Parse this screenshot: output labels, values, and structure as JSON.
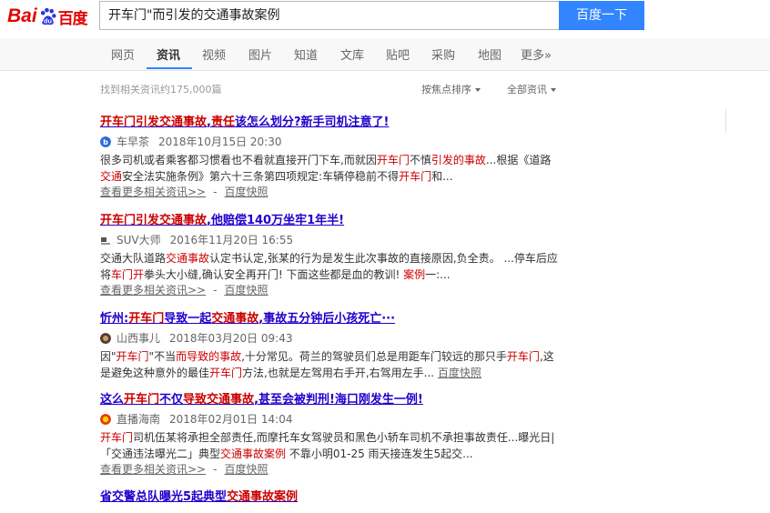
{
  "logo": {
    "left": "Bai",
    "right": "百度",
    "brand_color": "#e10601"
  },
  "search": {
    "query": "开车门\"而引发的交通事故案例",
    "button_label": "百度一下",
    "accent": "#3385ff"
  },
  "nav": [
    "网页",
    "资讯",
    "视频",
    "图片",
    "知道",
    "文库",
    "贴吧",
    "采购",
    "地图",
    "更多»"
  ],
  "nav_active": "资讯",
  "stats": "找到相关资讯约175,000篇",
  "sort": {
    "focus": "按焦点排序",
    "all": "全部资讯"
  },
  "results": [
    {
      "title_parts": [
        [
          "开车门引发交通事故",
          true
        ],
        [
          ",",
          false
        ],
        [
          "责任",
          true
        ],
        [
          "该怎么划分?新手司机注意了!",
          false
        ]
      ],
      "source_icon": "car-icon",
      "source": "车早茶",
      "date": "2018年10月15日 20:30",
      "abstract_parts": [
        [
          "很多司机或者乘客都习惯看也不看就直接开门下车,而就因",
          false
        ],
        [
          "开车门",
          true
        ],
        [
          "不慎",
          false
        ],
        [
          "引发的事故",
          true
        ],
        [
          "...根据《道路",
          false
        ],
        [
          "交通",
          true
        ],
        [
          "安全法实施条例》第六十三条第四项规定:车辆停稳前不得",
          false
        ],
        [
          "开车门",
          true
        ],
        [
          "和...",
          false
        ]
      ],
      "more": "查看更多相关资讯>>",
      "snapshot": "百度快照",
      "sep": "-"
    },
    {
      "title_parts": [
        [
          "开车门引发交通事故",
          true
        ],
        [
          ",他赔偿140万坐牢1年半!",
          false
        ]
      ],
      "source_icon": "suv-icon",
      "source": "SUV大师",
      "date": "2016年11月20日 16:55",
      "abstract_parts": [
        [
          "交通大队道路",
          false
        ],
        [
          "交通事故",
          true
        ],
        [
          "认定书认定,张某的行为是发生此次事故的直接原因,负全责。 ...停车后应将",
          false
        ],
        [
          "车门开",
          true
        ],
        [
          "拳头大小缝,确认安全再开门! 下面这些都是血的教训! ",
          false
        ],
        [
          "案例",
          true
        ],
        [
          "一:...",
          false
        ]
      ],
      "more": "查看更多相关资讯>>",
      "snapshot": "百度快照",
      "sep": "-"
    },
    {
      "title_parts": [
        [
          "忻州:",
          false
        ],
        [
          "开车门",
          true
        ],
        [
          "导致一起",
          false
        ],
        [
          "交通事故",
          true
        ],
        [
          ",事故五分钟后小孩死亡···",
          false
        ]
      ],
      "source_icon": "shanxi-icon",
      "source": "山西事儿",
      "date": "2018年03月20日 09:43",
      "abstract_parts": [
        [
          "因\"",
          false
        ],
        [
          "开车门",
          true
        ],
        [
          "\"不当",
          false
        ],
        [
          "而导致的事故",
          true
        ],
        [
          ",十分常见。荷兰的驾驶员们总是用距车门较远的那只手",
          false
        ],
        [
          "开车门",
          true
        ],
        [
          ",这是避免这种意外的最佳",
          false
        ],
        [
          "开车门",
          true
        ],
        [
          "方法,也就是左驾用右手开,右驾用左手... ",
          false
        ]
      ],
      "more": "",
      "snapshot": "百度快照",
      "sep": ""
    },
    {
      "title_parts": [
        [
          "这么",
          false
        ],
        [
          "开车门",
          true
        ],
        [
          "不仅",
          false
        ],
        [
          "导致交通事故",
          true
        ],
        [
          ",甚至会被判刑!海口刚发生一例!",
          false
        ]
      ],
      "source_icon": "haikou-icon",
      "source": "直播海南",
      "date": "2018年02月01日 14:04",
      "abstract_parts": [
        [
          "开车门",
          true
        ],
        [
          "司机伍某将承担全部责任,而摩托车女驾驶员和黑色小轿车司机不承担事故责任...曝光日|「交通违法曝光二」典型",
          false
        ],
        [
          "交通事故案例",
          true
        ],
        [
          " 不靠小明01-25 雨天接连发生5起交...",
          false
        ]
      ],
      "more": "查看更多相关资讯>>",
      "snapshot": "百度快照",
      "sep": "-"
    },
    {
      "title_parts": [
        [
          "省交警总队曝光5起典型",
          false
        ],
        [
          "交通事故案例",
          true
        ]
      ],
      "source_icon": "",
      "source": "",
      "date": "",
      "abstract_parts": [],
      "more": "",
      "snapshot": "",
      "sep": ""
    }
  ]
}
